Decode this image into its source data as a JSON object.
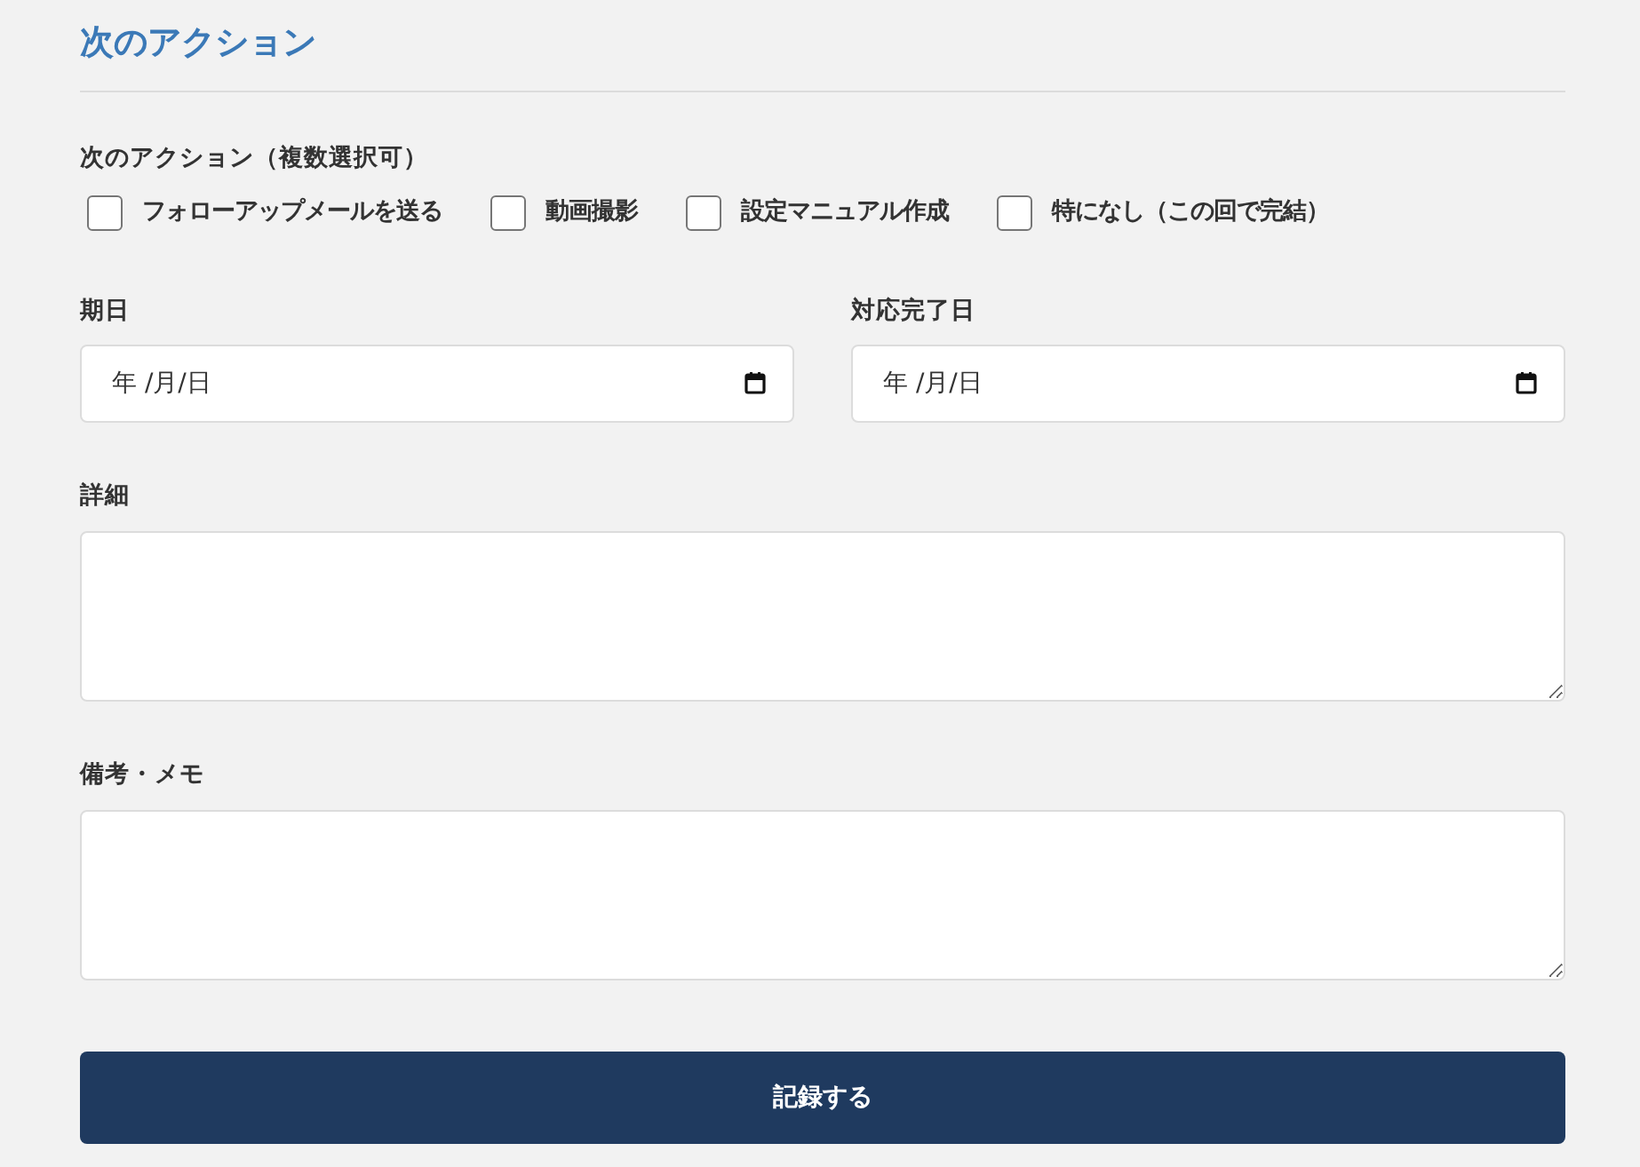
{
  "section": {
    "title": "次のアクション"
  },
  "next_actions": {
    "label": "次のアクション（複数選択可）",
    "options": [
      {
        "label": "フォローアップメールを送る",
        "checked": false
      },
      {
        "label": "動画撮影",
        "checked": false
      },
      {
        "label": "設定マニュアル作成",
        "checked": false
      },
      {
        "label": "特になし（この回で完結）",
        "checked": false
      }
    ]
  },
  "dates": [
    {
      "label": "期日",
      "placeholder": "年 /月/日"
    },
    {
      "label": "対応完了日",
      "placeholder": "年 /月/日"
    }
  ],
  "notes": [
    {
      "label": "詳細"
    },
    {
      "label": "備考・メモ"
    }
  ],
  "submit_button": {
    "label": "記録する"
  }
}
